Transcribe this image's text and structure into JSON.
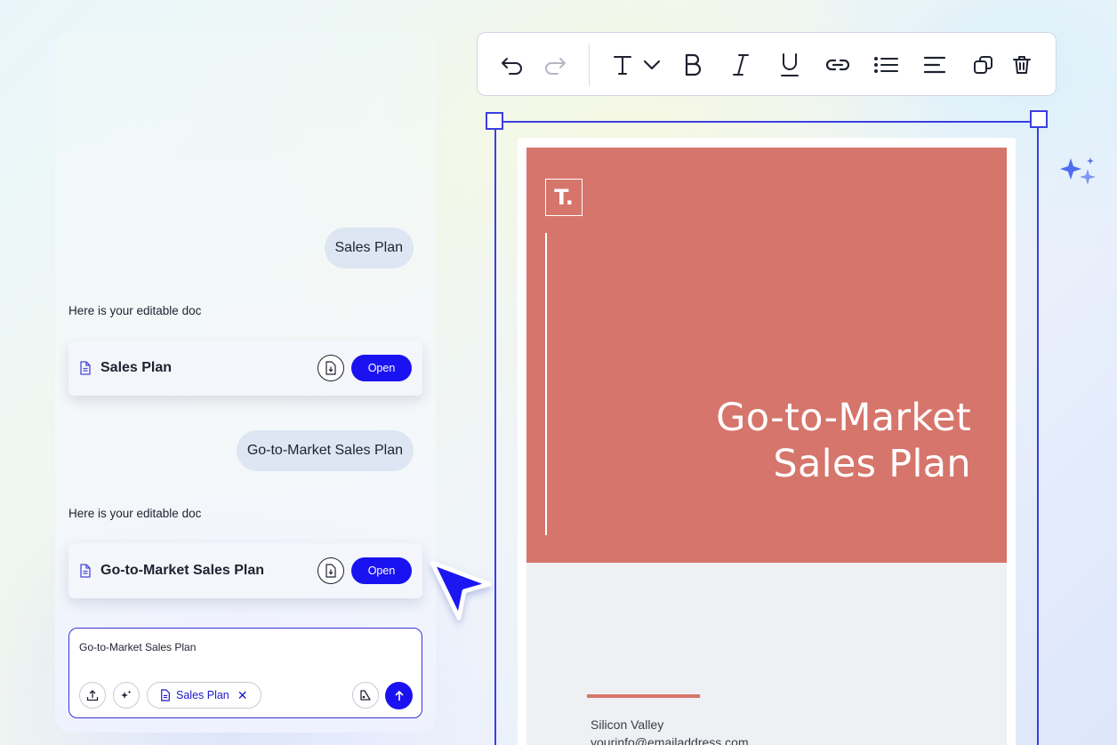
{
  "chat": {
    "messages": [
      {
        "role": "user",
        "text": "Sales Plan"
      },
      {
        "role": "assistant",
        "text": "Here is your editable doc",
        "doc_title": "Sales Plan",
        "open_label": "Open"
      },
      {
        "role": "user",
        "text": "Go-to-Market Sales Plan"
      },
      {
        "role": "assistant",
        "text": "Here is your editable doc",
        "doc_title": "Go-to-Market Sales Plan",
        "open_label": "Open"
      }
    ],
    "composer": {
      "text": "Go-to-Market Sales Plan",
      "attachment_chip": "Sales Plan"
    }
  },
  "toolbar": {
    "icons": [
      "undo-icon",
      "redo-icon",
      "text-style-icon",
      "chevron-down-icon",
      "bold-icon",
      "italic-icon",
      "underline-icon",
      "link-icon",
      "bullet-list-icon",
      "align-left-icon",
      "duplicate-icon",
      "delete-icon"
    ]
  },
  "document": {
    "logo": "T.",
    "headline_line1": "Go-to-Market",
    "headline_line2": "Sales Plan",
    "location": "Silicon Valley",
    "email": "yourinfo@emailaddress.com"
  },
  "colors": {
    "accent_blue": "#1a12f0",
    "cover": "#d6756b",
    "selection": "#3a3fe0"
  }
}
